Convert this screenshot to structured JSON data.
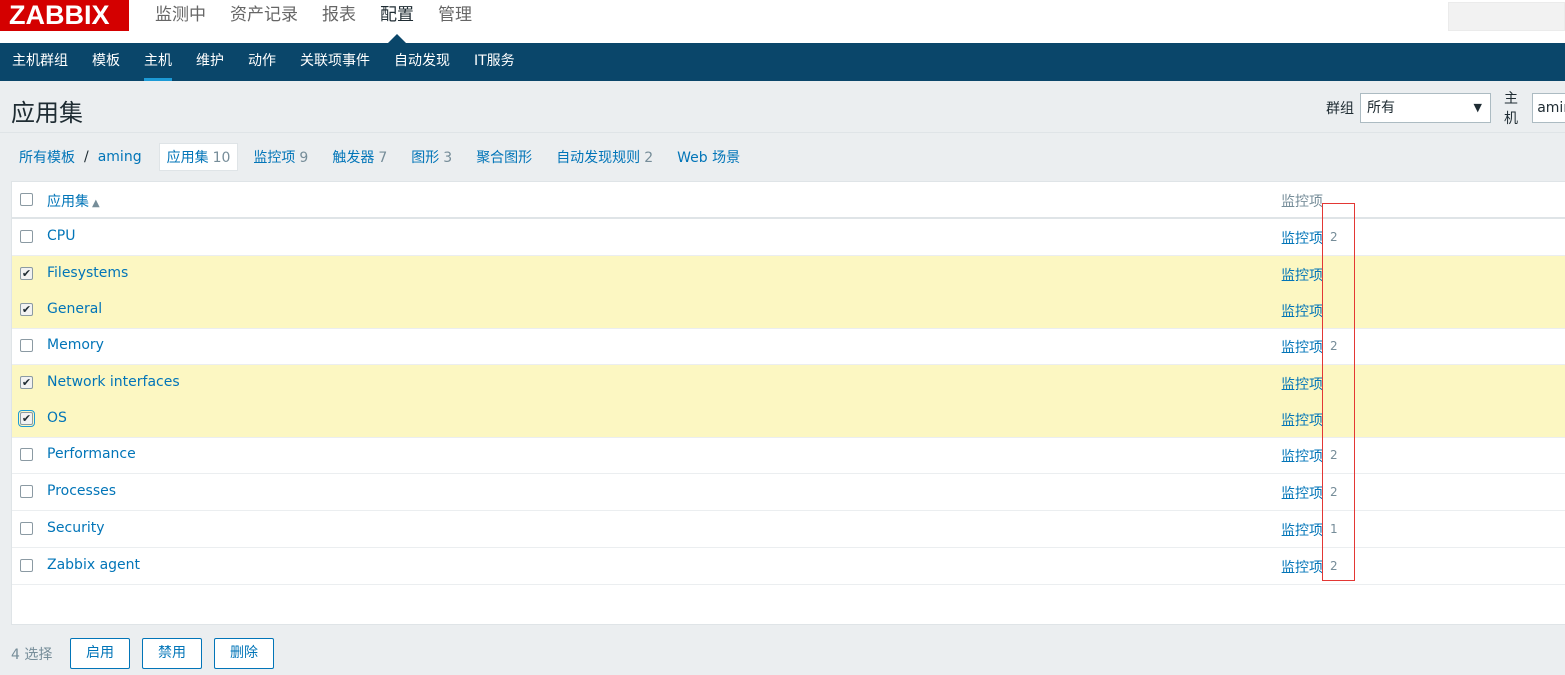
{
  "app": {
    "logo": "ZABBIX"
  },
  "main_menu": [
    {
      "label": "监测中",
      "active": false
    },
    {
      "label": "资产记录",
      "active": false
    },
    {
      "label": "报表",
      "active": false
    },
    {
      "label": "配置",
      "active": true
    },
    {
      "label": "管理",
      "active": false
    }
  ],
  "sub_menu": [
    {
      "label": "主机群组",
      "active": false
    },
    {
      "label": "模板",
      "active": false
    },
    {
      "label": "主机",
      "active": true
    },
    {
      "label": "维护",
      "active": false
    },
    {
      "label": "动作",
      "active": false
    },
    {
      "label": "关联项事件",
      "active": false
    },
    {
      "label": "自动发现",
      "active": false
    },
    {
      "label": "IT服务",
      "active": false
    }
  ],
  "header": {
    "title": "应用集",
    "group_label": "群组",
    "group_value": "所有",
    "host_label": "主机",
    "host_value": "aming"
  },
  "breadcrumbs": {
    "all_templates": "所有模板",
    "separator": "/",
    "host": "aming",
    "tabs": [
      {
        "label": "应用集",
        "count": "10",
        "current": true
      },
      {
        "label": "监控项",
        "count": "9",
        "current": false
      },
      {
        "label": "触发器",
        "count": "7",
        "current": false
      },
      {
        "label": "图形",
        "count": "3",
        "current": false
      },
      {
        "label": "聚合图形",
        "count": "",
        "current": false
      },
      {
        "label": "自动发现规则",
        "count": "2",
        "current": false
      },
      {
        "label": "Web 场景",
        "count": "",
        "current": false
      }
    ]
  },
  "table": {
    "col_name": "应用集",
    "sort_icon": "▲",
    "col_items": "监控项",
    "rows": [
      {
        "name": "CPU",
        "items_label": "监控项",
        "count": "2",
        "checked": false
      },
      {
        "name": "Filesystems",
        "items_label": "监控项",
        "count": "",
        "checked": true
      },
      {
        "name": "General",
        "items_label": "监控项",
        "count": "",
        "checked": true
      },
      {
        "name": "Memory",
        "items_label": "监控项",
        "count": "2",
        "checked": false
      },
      {
        "name": "Network interfaces",
        "items_label": "监控项",
        "count": "",
        "checked": true
      },
      {
        "name": "OS",
        "items_label": "监控项",
        "count": "",
        "checked": true
      },
      {
        "name": "Performance",
        "items_label": "监控项",
        "count": "2",
        "checked": false
      },
      {
        "name": "Processes",
        "items_label": "监控项",
        "count": "2",
        "checked": false
      },
      {
        "name": "Security",
        "items_label": "监控项",
        "count": "1",
        "checked": false
      },
      {
        "name": "Zabbix agent",
        "items_label": "监控项",
        "count": "2",
        "checked": false
      }
    ]
  },
  "footer": {
    "selected": "4 选择",
    "enable": "启用",
    "disable": "禁用",
    "delete": "删除"
  },
  "colors": {
    "brand_red": "#d40000",
    "nav_blue": "#0a466a",
    "link_blue": "#0275b8",
    "selected_row": "#fcf7c2",
    "annotation_red": "#e33734"
  }
}
